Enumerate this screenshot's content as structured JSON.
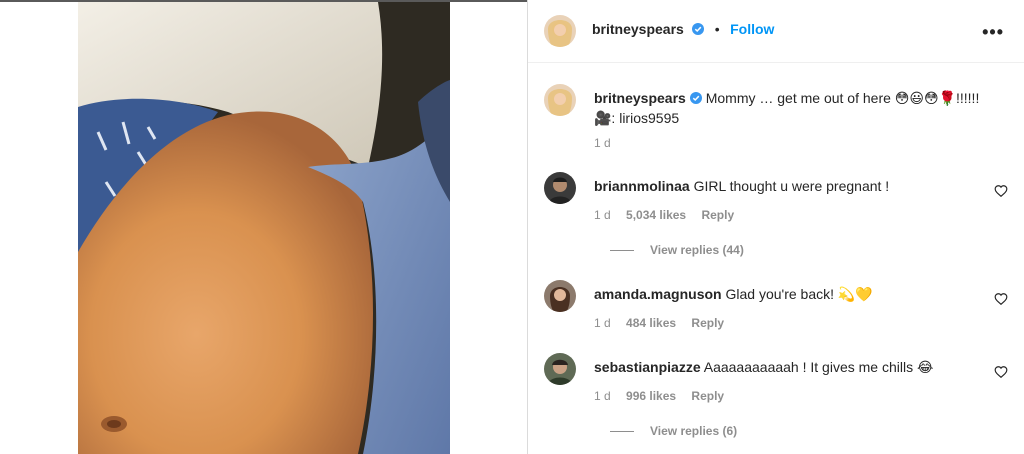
{
  "post": {
    "author": "britneyspears",
    "follow_label": "Follow",
    "separator": "•",
    "more_label": "•••",
    "caption_text": "Mommy … get me out of here 😳😃😳🌹!!!!!!",
    "caption_credit": "🎥: lirios9595",
    "caption_age": "1 d"
  },
  "comments": [
    {
      "username": "briannmolinaa",
      "text": "GIRL thought u were pregnant !",
      "age": "1 d",
      "likes": "5,034 likes",
      "reply": "Reply",
      "view_replies": "View replies (44)"
    },
    {
      "username": "amanda.magnuson",
      "text": "Glad you're back! 💫💛",
      "age": "1 d",
      "likes": "484 likes",
      "reply": "Reply",
      "view_replies": ""
    },
    {
      "username": "sebastianpiazze",
      "text": "Aaaaaaaaaaah ! It gives me chills 😂",
      "age": "1 d",
      "likes": "996 likes",
      "reply": "Reply",
      "view_replies": "View replies (6)"
    }
  ],
  "colors": {
    "accent": "#0095f6",
    "verified": "#3897f0",
    "muted": "#8e8e8e",
    "text": "#262626"
  },
  "icons": [
    "verified-icon",
    "more-options-icon",
    "heart-icon"
  ]
}
